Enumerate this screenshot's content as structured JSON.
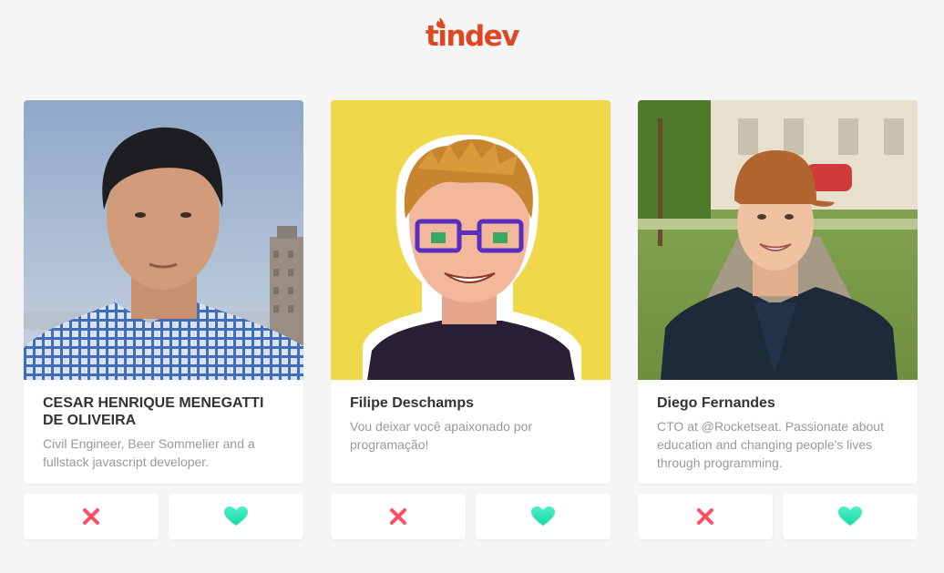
{
  "app": {
    "logo_text": "tindev",
    "brand_color": "#df4723",
    "dislike_color": "#ff4e63",
    "like_color": "#2ee8b8"
  },
  "developers": [
    {
      "name": "CESAR HENRIQUE MENEGATTI DE OLIVEIRA",
      "bio": "Civil Engineer, Beer Sommelier and a fullstack javascript developer.",
      "avatar": "photo-man-checkered-shirt-sky-background",
      "dislike_icon": "x-icon",
      "like_icon": "heart-icon"
    },
    {
      "name": "Filipe Deschamps",
      "bio": "Vou deixar você apaixonado por programação!",
      "avatar": "pixel-art-avatar-glasses-yellow-background",
      "dislike_icon": "x-icon",
      "like_icon": "heart-icon"
    },
    {
      "name": "Diego Fernandes",
      "bio": "CTO at @Rocketseat. Passionate about education and changing people's lives through programming.",
      "avatar": "photo-man-cap-leather-jacket-park",
      "dislike_icon": "x-icon",
      "like_icon": "heart-icon"
    }
  ]
}
